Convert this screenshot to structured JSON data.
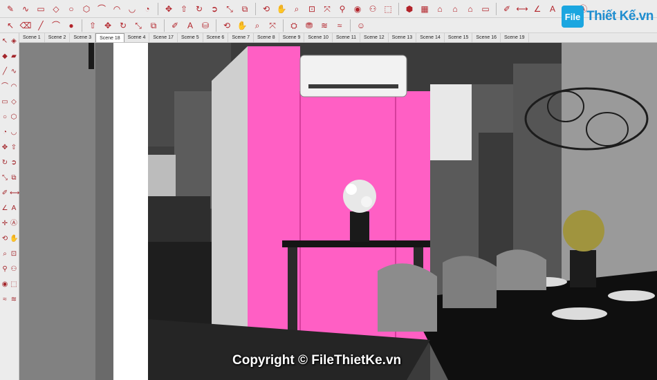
{
  "app": "SketchUp",
  "toolbar1": {
    "buttons": [
      {
        "name": "pencil-icon",
        "glyph": "✎"
      },
      {
        "name": "freehand-icon",
        "glyph": "∿"
      },
      {
        "name": "rectangle-icon",
        "glyph": "▭"
      },
      {
        "name": "rotated-rectangle-icon",
        "glyph": "◇"
      },
      {
        "name": "circle-icon",
        "glyph": "○"
      },
      {
        "name": "polygon-icon",
        "glyph": "⬡"
      },
      {
        "name": "arc-icon",
        "glyph": "⌒"
      },
      {
        "name": "two-point-arc-icon",
        "glyph": "◠"
      },
      {
        "name": "three-point-arc-icon",
        "glyph": "◡"
      },
      {
        "name": "pie-icon",
        "glyph": "◔"
      },
      {
        "name": "move-icon",
        "glyph": "✥"
      },
      {
        "name": "push-pull-icon",
        "glyph": "⇧"
      },
      {
        "name": "rotate-icon",
        "glyph": "↻"
      },
      {
        "name": "follow-me-icon",
        "glyph": "➲"
      },
      {
        "name": "scale-icon",
        "glyph": "⤡"
      },
      {
        "name": "offset-icon",
        "glyph": "⧉"
      },
      {
        "name": "orbit-icon",
        "glyph": "⟲"
      },
      {
        "name": "pan-icon",
        "glyph": "✋"
      },
      {
        "name": "zoom-icon",
        "glyph": "⌕"
      },
      {
        "name": "zoom-window-icon",
        "glyph": "⊡"
      },
      {
        "name": "zoom-extents-icon",
        "glyph": "⤧"
      },
      {
        "name": "position-camera-icon",
        "glyph": "⚲"
      },
      {
        "name": "look-around-icon",
        "glyph": "◉"
      },
      {
        "name": "walk-icon",
        "glyph": "⚇"
      },
      {
        "name": "section-plane-icon",
        "glyph": "⬚"
      },
      {
        "name": "iso-view-icon",
        "glyph": "⬢"
      },
      {
        "name": "top-view-icon",
        "glyph": "▦"
      },
      {
        "name": "front-view-icon",
        "glyph": "⌂"
      },
      {
        "name": "right-view-icon",
        "glyph": "⌂"
      },
      {
        "name": "back-view-icon",
        "glyph": "⌂"
      },
      {
        "name": "left-view-icon",
        "glyph": "▭"
      },
      {
        "name": "tape-measure-icon",
        "glyph": "✐"
      },
      {
        "name": "dimension-icon",
        "glyph": "⟷"
      },
      {
        "name": "protractor-icon",
        "glyph": "∠"
      },
      {
        "name": "text-icon",
        "glyph": "A"
      },
      {
        "name": "axes-icon",
        "glyph": "✛"
      },
      {
        "name": "3d-text-icon",
        "glyph": "Ⓐ"
      }
    ]
  },
  "toolbar2": {
    "buttons": [
      {
        "name": "select-icon",
        "glyph": "↖"
      },
      {
        "name": "eraser-icon",
        "glyph": "⌫"
      },
      {
        "name": "line-icon",
        "glyph": "╱"
      },
      {
        "name": "arc-draw-icon",
        "glyph": "⌒"
      },
      {
        "name": "shape-icon",
        "glyph": "●"
      },
      {
        "name": "push-pull-icon",
        "glyph": "⇧"
      },
      {
        "name": "move-icon",
        "glyph": "✥"
      },
      {
        "name": "rotate-icon",
        "glyph": "↻"
      },
      {
        "name": "scale-icon",
        "glyph": "⤡"
      },
      {
        "name": "offset-icon",
        "glyph": "⧉"
      },
      {
        "name": "tape-measure-icon",
        "glyph": "✐"
      },
      {
        "name": "text-icon",
        "glyph": "A"
      },
      {
        "name": "paint-bucket-icon",
        "glyph": "⛁"
      },
      {
        "name": "orbit-icon",
        "glyph": "⟲"
      },
      {
        "name": "pan-icon",
        "glyph": "✋"
      },
      {
        "name": "zoom-icon",
        "glyph": "⌕"
      },
      {
        "name": "zoom-extents-icon",
        "glyph": "⤧"
      },
      {
        "name": "3d-warehouse-icon",
        "glyph": "⛭"
      },
      {
        "name": "extension-warehouse-icon",
        "glyph": "⛃"
      },
      {
        "name": "layout-icon",
        "glyph": "≋"
      },
      {
        "name": "sandbox-icon",
        "glyph": "≈"
      },
      {
        "name": "account-icon",
        "glyph": "☺"
      }
    ]
  },
  "scene_tabs": {
    "active": "Scene 18",
    "labels": [
      "Scene 1",
      "Scene 2",
      "Scene 3",
      "Scene 18",
      "Scene 4",
      "Scene 17",
      "Scene 5",
      "Scene 6",
      "Scene 7",
      "Scene 8",
      "Scene 9",
      "Scene 10",
      "Scene 11",
      "Scene 12",
      "Scene 13",
      "Scene 14",
      "Scene 15",
      "Scene 16",
      "Scene 19"
    ]
  },
  "left_tools": {
    "buttons": [
      {
        "name": "select-icon",
        "glyph": "↖"
      },
      {
        "name": "component-icon",
        "glyph": "◈"
      },
      {
        "name": "paint-icon",
        "glyph": "◆"
      },
      {
        "name": "eraser-icon",
        "glyph": "▰"
      },
      {
        "name": "line-icon",
        "glyph": "╱"
      },
      {
        "name": "freehand-icon",
        "glyph": "∿"
      },
      {
        "name": "arc-icon",
        "glyph": "⌒"
      },
      {
        "name": "two-point-arc-icon",
        "glyph": "◠"
      },
      {
        "name": "rectangle-icon",
        "glyph": "▭"
      },
      {
        "name": "rotated-rectangle-icon",
        "glyph": "◇"
      },
      {
        "name": "circle-icon",
        "glyph": "○"
      },
      {
        "name": "polygon-icon",
        "glyph": "⬡"
      },
      {
        "name": "pie-icon",
        "glyph": "◔"
      },
      {
        "name": "three-point-arc-icon",
        "glyph": "◡"
      },
      {
        "name": "move-icon",
        "glyph": "✥"
      },
      {
        "name": "push-pull-icon",
        "glyph": "⇧"
      },
      {
        "name": "rotate-icon",
        "glyph": "↻"
      },
      {
        "name": "follow-me-icon",
        "glyph": "➲"
      },
      {
        "name": "scale-icon",
        "glyph": "⤡"
      },
      {
        "name": "offset-icon",
        "glyph": "⧉"
      },
      {
        "name": "tape-measure-icon",
        "glyph": "✐"
      },
      {
        "name": "dimension-icon",
        "glyph": "⟷"
      },
      {
        "name": "protractor-icon",
        "glyph": "∠"
      },
      {
        "name": "text-icon",
        "glyph": "A"
      },
      {
        "name": "axes-icon",
        "glyph": "✛"
      },
      {
        "name": "3d-text-icon",
        "glyph": "Ⓐ"
      },
      {
        "name": "orbit-icon",
        "glyph": "⟲"
      },
      {
        "name": "pan-icon",
        "glyph": "✋"
      },
      {
        "name": "zoom-icon",
        "glyph": "⌕"
      },
      {
        "name": "zoom-window-icon",
        "glyph": "⊡"
      },
      {
        "name": "position-camera-icon",
        "glyph": "⚲"
      },
      {
        "name": "walk-icon",
        "glyph": "⚇"
      },
      {
        "name": "look-around-icon",
        "glyph": "◉"
      },
      {
        "name": "section-plane-icon",
        "glyph": "⬚"
      },
      {
        "name": "sandbox-icon",
        "glyph": "≈"
      },
      {
        "name": "layout-icon",
        "glyph": "≋"
      }
    ]
  },
  "watermark": {
    "logo_icon": "File",
    "logo_text": "Thiết Kế.vn",
    "copyright": "Copyright © FileThietKe.vn"
  },
  "colors": {
    "accent_wall": "#ff5fc4",
    "toolbar_bg": "#ececec",
    "brand": "#1e8dcf"
  }
}
